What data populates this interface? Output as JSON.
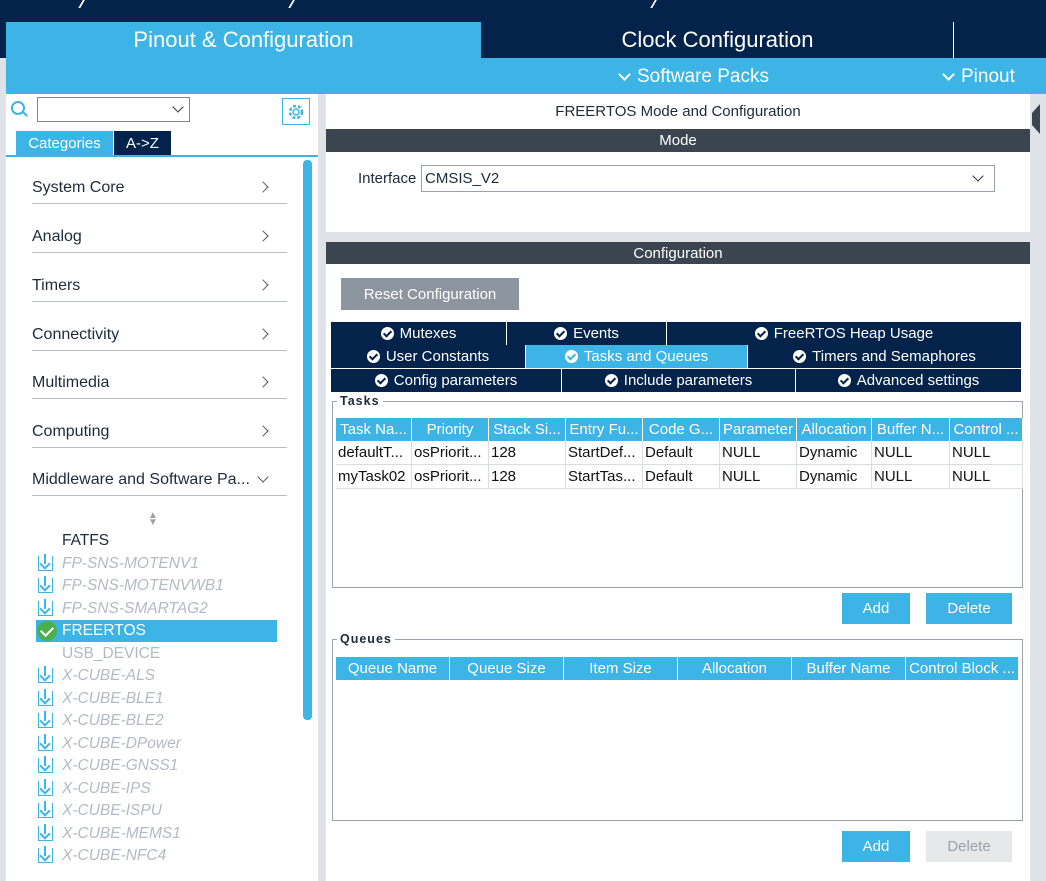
{
  "header": {
    "tabs": [
      {
        "label": "Pinout & Configuration",
        "active": true
      },
      {
        "label": "Clock Configuration",
        "active": false
      }
    ],
    "sub_menu": {
      "software_packs": "Software Packs",
      "pinout": "Pinout"
    }
  },
  "sidebar": {
    "search": {
      "value": "",
      "placeholder": ""
    },
    "tabs": {
      "categories": "Categories",
      "az": "A->Z"
    },
    "categories": [
      {
        "label": "System Core"
      },
      {
        "label": "Analog"
      },
      {
        "label": "Timers"
      },
      {
        "label": "Connectivity"
      },
      {
        "label": "Multimedia"
      },
      {
        "label": "Computing"
      },
      {
        "label": "Middleware and Software Pa..."
      }
    ],
    "middleware_items": [
      {
        "label": "FATFS",
        "icon": "none",
        "state": "enabled"
      },
      {
        "label": "FP-SNS-MOTENV1",
        "icon": "download-icon",
        "state": "disabled"
      },
      {
        "label": "FP-SNS-MOTENVWB1",
        "icon": "download-icon",
        "state": "disabled"
      },
      {
        "label": "FP-SNS-SMARTAG2",
        "icon": "download-icon",
        "state": "disabled"
      },
      {
        "label": "FREERTOS",
        "icon": "check-circle-icon",
        "state": "selected"
      },
      {
        "label": "USB_DEVICE",
        "icon": "none",
        "state": "unavailable"
      },
      {
        "label": "X-CUBE-ALS",
        "icon": "download-icon",
        "state": "disabled"
      },
      {
        "label": "X-CUBE-BLE1",
        "icon": "download-icon",
        "state": "disabled"
      },
      {
        "label": "X-CUBE-BLE2",
        "icon": "download-icon",
        "state": "disabled"
      },
      {
        "label": "X-CUBE-DPower",
        "icon": "download-icon",
        "state": "disabled"
      },
      {
        "label": "X-CUBE-GNSS1",
        "icon": "download-icon",
        "state": "disabled"
      },
      {
        "label": "X-CUBE-IPS",
        "icon": "download-icon",
        "state": "disabled"
      },
      {
        "label": "X-CUBE-ISPU",
        "icon": "download-icon",
        "state": "disabled"
      },
      {
        "label": "X-CUBE-MEMS1",
        "icon": "download-icon",
        "state": "disabled"
      },
      {
        "label": "X-CUBE-NFC4",
        "icon": "download-icon",
        "state": "disabled"
      }
    ]
  },
  "main": {
    "title": "FREERTOS Mode and Configuration",
    "mode": {
      "header": "Mode",
      "interface_label": "Interface",
      "interface_value": "CMSIS_V2"
    },
    "configuration": {
      "header": "Configuration",
      "reset_label": "Reset Configuration",
      "tab_rows": [
        [
          "Mutexes",
          "Events",
          "FreeRTOS Heap Usage"
        ],
        [
          "User Constants",
          "Tasks and Queues",
          "Timers and Semaphores"
        ],
        [
          "Config parameters",
          "Include parameters",
          "Advanced settings"
        ]
      ],
      "active_tab": "Tasks and Queues",
      "tasks": {
        "legend": "Tasks",
        "columns": [
          "Task Na...",
          "Priority",
          "Stack Si...",
          "Entry Fu...",
          "Code G...",
          "Parameter",
          "Allocation",
          "Buffer N...",
          "Control ..."
        ],
        "rows": [
          [
            "defaultT...",
            "osPriorit...",
            "128",
            "StartDef...",
            "Default",
            "NULL",
            "Dynamic",
            "NULL",
            "NULL"
          ],
          [
            "myTask02",
            "osPriorit...",
            "128",
            "StartTas...",
            "Default",
            "NULL",
            "Dynamic",
            "NULL",
            "NULL"
          ]
        ],
        "add_label": "Add",
        "delete_label": "Delete"
      },
      "queues": {
        "legend": "Queues",
        "columns": [
          "Queue Name",
          "Queue Size",
          "Item Size",
          "Allocation",
          "Buffer Name",
          "Control Block ..."
        ],
        "rows": [],
        "add_label": "Add",
        "delete_label": "Delete"
      }
    }
  },
  "colors": {
    "accent": "#3cb4e6",
    "navy": "#03234b",
    "section_header": "#3b4550",
    "success": "#4bb04b"
  }
}
